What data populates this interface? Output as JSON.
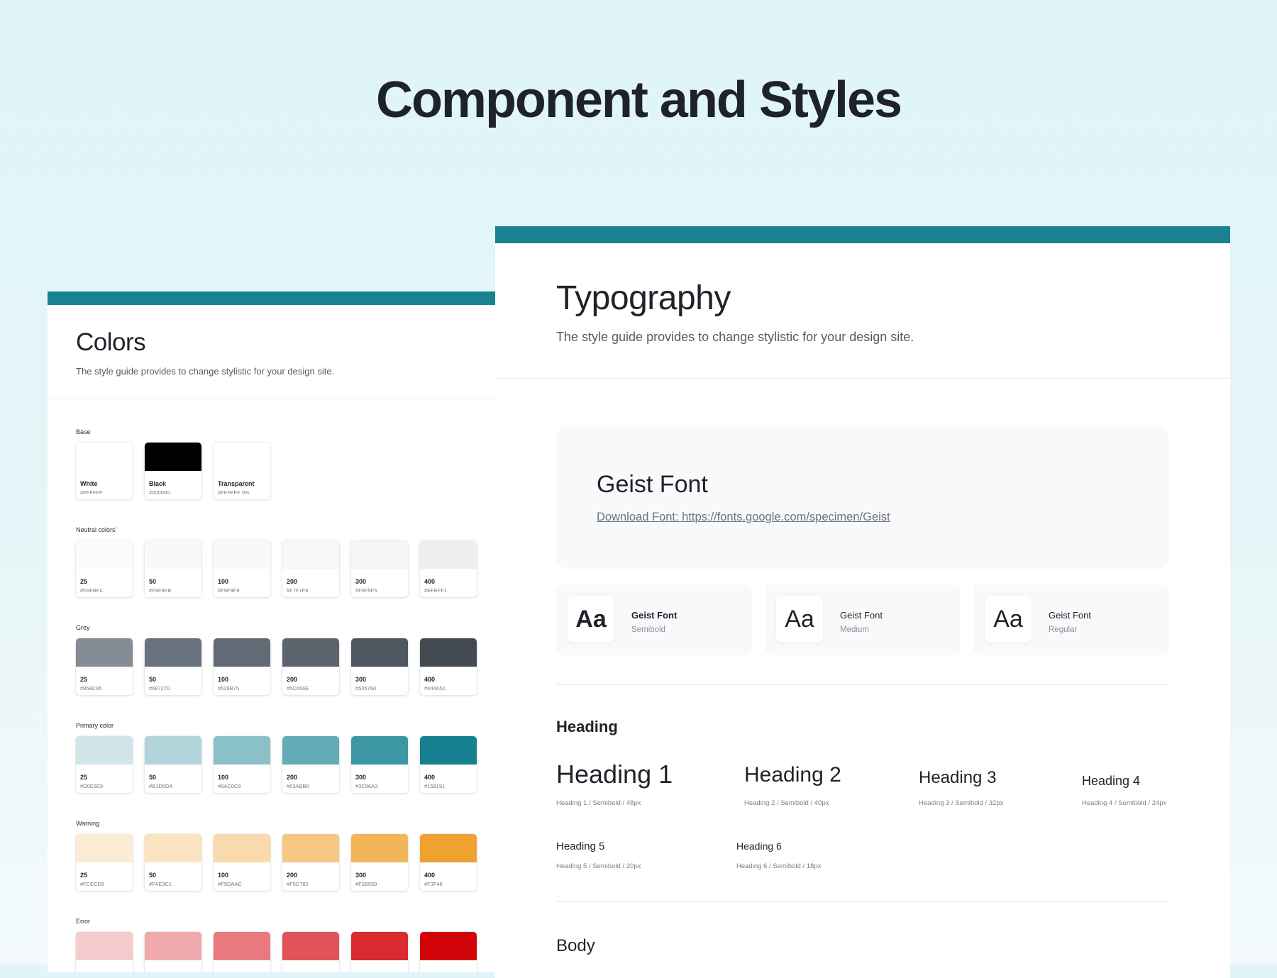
{
  "page": {
    "title": "Component and Styles"
  },
  "colors_panel": {
    "title": "Colors",
    "description": "The style guide provides to change stylistic for your design site.",
    "groups": [
      {
        "label": "Base",
        "swatches": [
          {
            "name": "White",
            "hex": "#FFFFFF",
            "color": "#FFFFFF"
          },
          {
            "name": "Black",
            "hex": "#000000",
            "color": "#000000"
          },
          {
            "name": "Transparent",
            "hex": "#FFFFFF 0%",
            "color": "#FFFFFF"
          }
        ]
      },
      {
        "label": "Neutral colors'",
        "swatches": [
          {
            "name": "25",
            "hex": "#FAFBFC",
            "color": "#FAFBFC"
          },
          {
            "name": "50",
            "hex": "#F8F9FB",
            "color": "#F8F9FB"
          },
          {
            "name": "100",
            "hex": "#F9F9F9",
            "color": "#F9F9F9"
          },
          {
            "name": "200",
            "hex": "#F7F7F8",
            "color": "#F7F7F8"
          },
          {
            "name": "300",
            "hex": "#F5F5F5",
            "color": "#F5F5F5"
          },
          {
            "name": "400",
            "hex": "#EFEFF1",
            "color": "#EFEFF1"
          }
        ]
      },
      {
        "label": "Grey",
        "swatches": [
          {
            "name": "25",
            "hex": "#858C95",
            "color": "#858C95"
          },
          {
            "name": "50",
            "hex": "#68727D",
            "color": "#68727D"
          },
          {
            "name": "100",
            "hex": "#626B75",
            "color": "#626B75"
          },
          {
            "name": "200",
            "hex": "#5C656E",
            "color": "#5C656E"
          },
          {
            "name": "300",
            "hex": "#505760",
            "color": "#505760"
          },
          {
            "name": "400",
            "hex": "#444A51",
            "color": "#444A51"
          }
        ]
      },
      {
        "label": "Primary color",
        "swatches": [
          {
            "name": "25",
            "hex": "#D0E6E9",
            "color": "#D0E6E9"
          },
          {
            "name": "50",
            "hex": "#B1D5DA",
            "color": "#B1D5DA"
          },
          {
            "name": "100",
            "hex": "#8AC0C8",
            "color": "#8AC0C8"
          },
          {
            "name": "200",
            "hex": "#63ABB6",
            "color": "#63ABB6"
          },
          {
            "name": "300",
            "hex": "#3C96A3",
            "color": "#3C96A3"
          },
          {
            "name": "400",
            "hex": "#158191",
            "color": "#158191"
          }
        ]
      },
      {
        "label": "Warning",
        "swatches": [
          {
            "name": "25",
            "hex": "#FCECD5",
            "color": "#FCECD5"
          },
          {
            "name": "50",
            "hex": "#FAE3C1",
            "color": "#FAE3C1"
          },
          {
            "name": "100",
            "hex": "#F9DAAC",
            "color": "#F9DAAC"
          },
          {
            "name": "200",
            "hex": "#F5C782",
            "color": "#F5C782"
          },
          {
            "name": "300",
            "hex": "#F2B559",
            "color": "#F2B559"
          },
          {
            "name": "400",
            "hex": "#F3F46",
            "color": "#EFA230"
          }
        ]
      },
      {
        "label": "Error",
        "swatches": [
          {
            "color": "#F5CBCD"
          },
          {
            "color": "#F0A9AC"
          },
          {
            "color": "#E8797E"
          },
          {
            "color": "#E05459"
          },
          {
            "color": "#D92B2F"
          },
          {
            "color": "#D20309"
          }
        ]
      }
    ]
  },
  "typography_panel": {
    "title": "Typography",
    "description": "The style guide provides to change stylistic for your design site.",
    "font_card": {
      "name": "Geist Font",
      "link": "Download Font: https://fonts.google.com/specimen/Geist"
    },
    "weights": [
      {
        "sample": "Aa",
        "name": "Geist Font",
        "weight": "Semibold"
      },
      {
        "sample": "Aa",
        "name": "Geist Font",
        "weight": "Medium"
      },
      {
        "sample": "Aa",
        "name": "Geist Font",
        "weight": "Regular"
      }
    ],
    "heading_section": {
      "title": "Heading",
      "items": [
        {
          "label": "Heading 1",
          "meta": "Heading 1 / Semibold / 48px"
        },
        {
          "label": "Heading 2",
          "meta": "Heading 2 / Semibold / 40px"
        },
        {
          "label": "Heading 3",
          "meta": "Heading 3 / Semibold / 32px"
        },
        {
          "label": "Heading 4",
          "meta": "Heading 4 / Semibold / 24px"
        },
        {
          "label": "Heading 5",
          "meta": "Heading 5 / Semibold / 20px"
        },
        {
          "label": "Heading 6",
          "meta": "Heading 6 / Semibold / 18px"
        }
      ]
    },
    "body_section": {
      "title": "Body"
    }
  },
  "colors": {
    "accent": "#1A8190"
  }
}
